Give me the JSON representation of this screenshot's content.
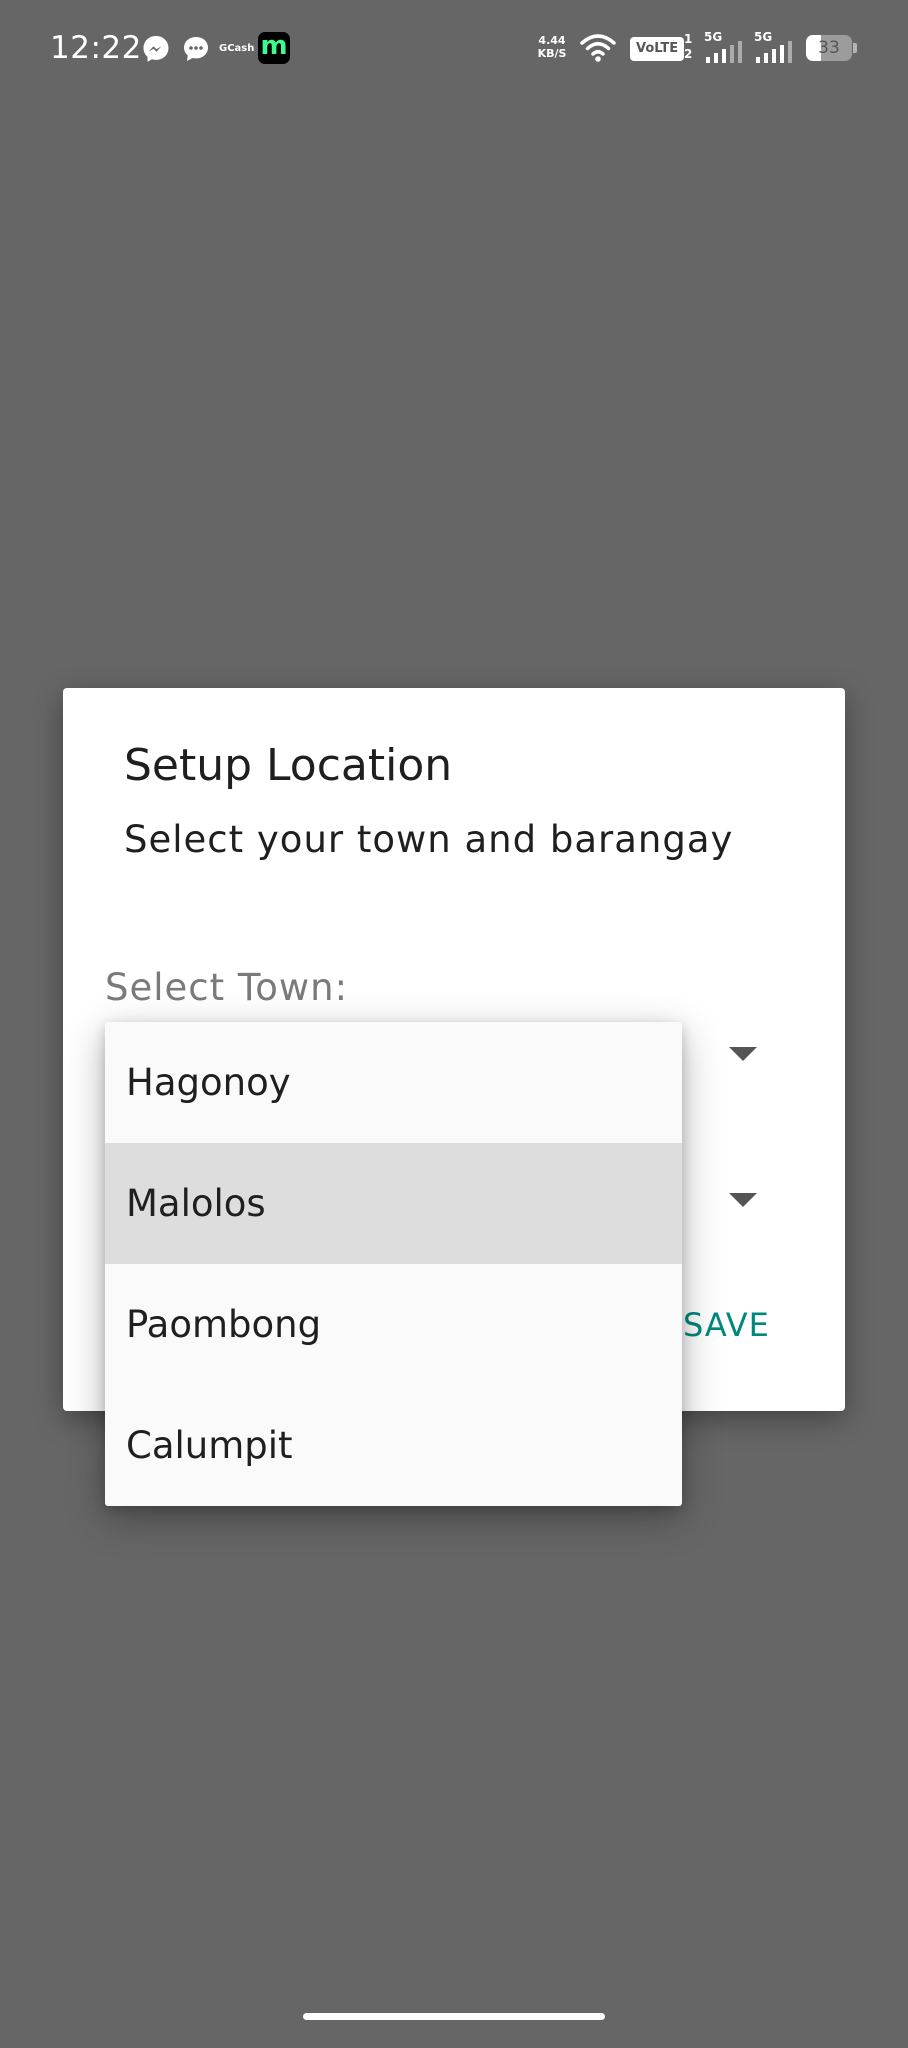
{
  "status_bar": {
    "time": "12:22",
    "gcash_label": "GCash",
    "maya_letter": "m",
    "net_speed_value": "4.44",
    "net_speed_unit": "KB/S",
    "volte": "VoLTE",
    "sim_top": "1",
    "sim_bottom": "2",
    "sim1_network": "5G",
    "sim2_network": "5G",
    "battery_level": "33",
    "battery_fraction": 0.33,
    "colors": {
      "maya_accent": "#3dfc8a",
      "messenger_bubble": "#ffffff",
      "text": "#ffffff"
    }
  },
  "dialog": {
    "title": "Setup Location",
    "subtitle": "Select your town and barangay",
    "town_label": "Select Town:",
    "save_label": "SAVE",
    "colors": {
      "accent": "#00897b",
      "scrim": "#666666"
    }
  },
  "dropdown": {
    "items": [
      {
        "label": "Hagonoy"
      },
      {
        "label": "Malolos"
      },
      {
        "label": "Paombong"
      },
      {
        "label": "Calumpit"
      }
    ],
    "highlighted_item": "Malolos",
    "icons": {
      "town_spinner": "caret-down-icon",
      "barangay_spinner": "caret-down-icon"
    }
  }
}
